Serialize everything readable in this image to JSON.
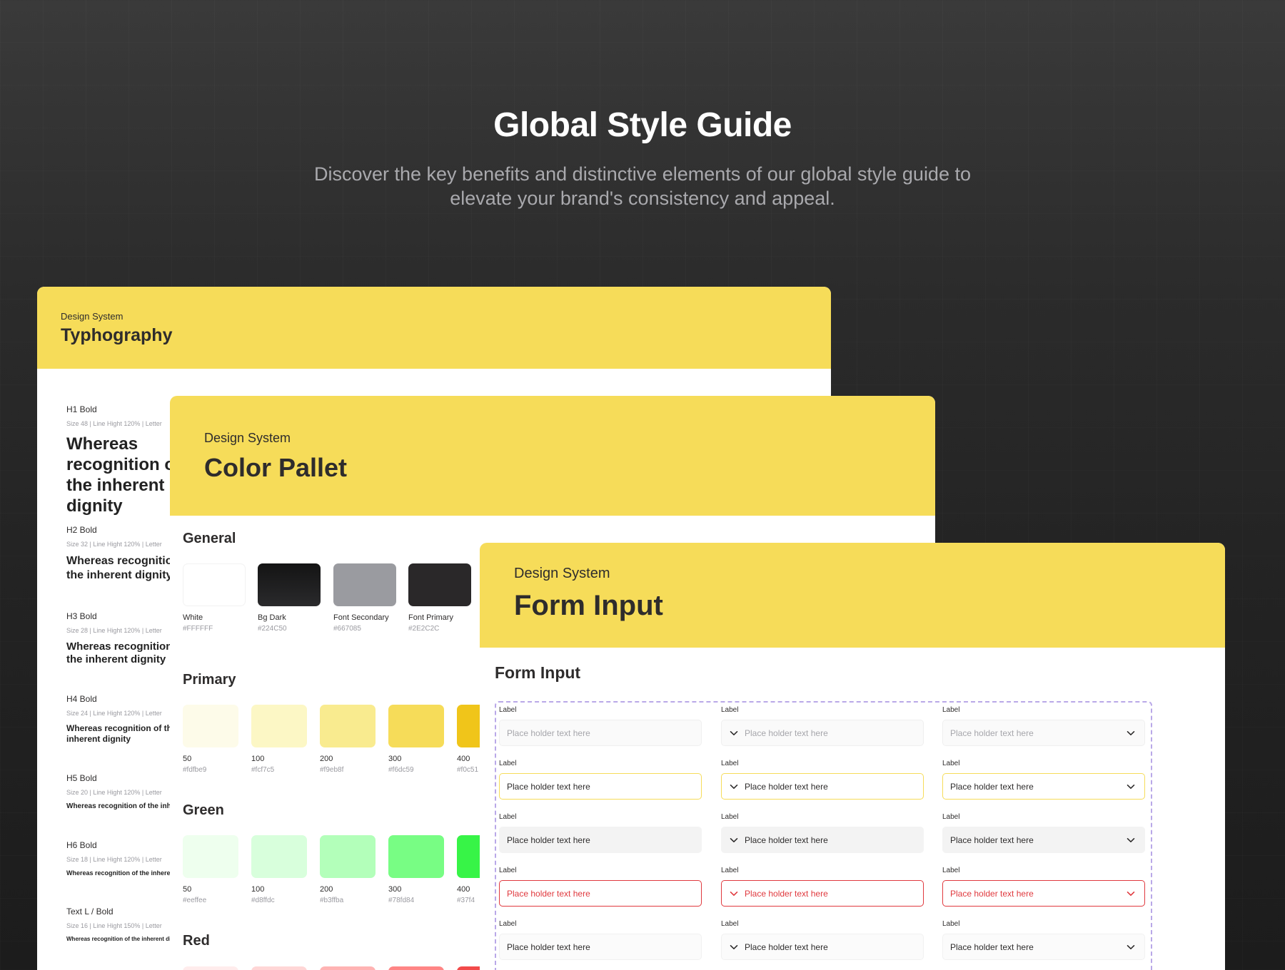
{
  "hero": {
    "title": "Global Style Guide",
    "subtitle": "Discover the key benefits and distinctive elements of our global style guide to elevate your brand's consistency and appeal."
  },
  "typography_card": {
    "kicker": "Design System",
    "title": "Typhography",
    "styles": [
      {
        "name": "H1 Bold",
        "meta": "Size 48  |  Line Hight 120%  |  Letter",
        "sample": "Whereas recognition of the inherent dignity"
      },
      {
        "name": "H2 Bold",
        "meta": "Size 32  |  Line Hight 120%  |  Letter",
        "sample": "Whereas recognition of the inherent dignity"
      },
      {
        "name": "H3 Bold",
        "meta": "Size 28  |  Line Hight 120%  |  Letter",
        "sample": "Whereas recognition of the inherent dignity"
      },
      {
        "name": "H4 Bold",
        "meta": "Size 24  |  Line Hight 120%  |  Letter",
        "sample": "Whereas recognition of the inherent dignity"
      },
      {
        "name": "H5 Bold",
        "meta": "Size 20  |  Line Hight 120%  |  Letter",
        "sample": "Whereas recognition of the inherent dignity"
      },
      {
        "name": "H6 Bold",
        "meta": "Size 18  |  Line Hight 120%  |  Letter",
        "sample": "Whereas recognition of the inherent dignity"
      },
      {
        "name": "Text L / Bold",
        "meta": "Size 16  |  Line Hight 150%  |  Letter",
        "sample": "Whereas recognition of the inherent dignity"
      }
    ]
  },
  "color_card": {
    "kicker": "Design System",
    "title": "Color Pallet",
    "general": {
      "title": "General",
      "swatches": [
        {
          "name": "White",
          "hex": "#FFFFFF",
          "color": "#FFFFFF"
        },
        {
          "name": "Bg Dark",
          "hex": "#224C50",
          "color": "#1d1d1f"
        },
        {
          "name": "Font Secondary",
          "hex": "#667085",
          "color": "#9a9ba0"
        },
        {
          "name": "Font Primary",
          "hex": "#2E2C2C",
          "color": "#2a2829"
        }
      ]
    },
    "primary": {
      "title": "Primary",
      "swatches": [
        {
          "name": "50",
          "hex": "#fdfbe9",
          "color": "#fdfbe9"
        },
        {
          "name": "100",
          "hex": "#fcf7c5",
          "color": "#fcf7c5"
        },
        {
          "name": "200",
          "hex": "#f9eb8f",
          "color": "#f9eb8f"
        },
        {
          "name": "300",
          "hex": "#f6dc59",
          "color": "#f6dc59"
        },
        {
          "name": "400",
          "hex": "#f0c51",
          "color": "#f0c51a"
        }
      ]
    },
    "green": {
      "title": "Green",
      "swatches": [
        {
          "name": "50",
          "hex": "#eeffee",
          "color": "#eeffee"
        },
        {
          "name": "100",
          "hex": "#d8ffdc",
          "color": "#d8ffdc"
        },
        {
          "name": "200",
          "hex": "#b3ffba",
          "color": "#b3ffba"
        },
        {
          "name": "300",
          "hex": "#78fd84",
          "color": "#78fd84"
        },
        {
          "name": "400",
          "hex": "#37f4",
          "color": "#37f447"
        }
      ]
    },
    "red": {
      "title": "Red",
      "swatches": [
        {
          "color": "#ffecec"
        },
        {
          "color": "#ffd6d6"
        },
        {
          "color": "#ffb3b3"
        },
        {
          "color": "#ff8585"
        },
        {
          "color": "#f24a4a"
        }
      ]
    }
  },
  "form_card": {
    "kicker": "Design System",
    "title": "Form Input",
    "heading": "Form Input",
    "label": "Label",
    "placeholder": "Place holder text here",
    "rows": [
      {
        "state": "empty"
      },
      {
        "state": "focus"
      },
      {
        "state": "filled"
      },
      {
        "state": "error"
      },
      {
        "state": "plain"
      }
    ]
  },
  "colors": {
    "accent_yellow": "#F6DC59",
    "error_red": "#e0393e",
    "frame_dashed": "#b9a8e8"
  }
}
